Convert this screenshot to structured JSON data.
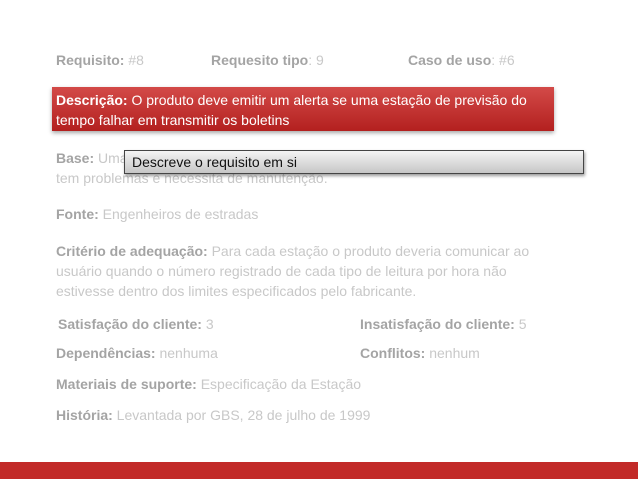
{
  "requisito": {
    "label": "Requisito:",
    "value": " #8"
  },
  "requisito_tipo": {
    "label": "Requesito tipo",
    "value": ": 9"
  },
  "caso_de_uso": {
    "label": "Caso de uso",
    "value": ": #6"
  },
  "descricao": {
    "label": "Descrição:",
    "value": " O produto deve emitir um alerta se uma estação de previsão do tempo falhar em transmitir  os boletins"
  },
  "base": {
    "label": "Base:",
    "value": " Uma estação de previsão do tempo que falha em transmitir seus boletins tem problemas e necessita de manutenção."
  },
  "callout": {
    "text": "Descreve o requisito em si"
  },
  "fonte": {
    "label": "Fonte:",
    "value": " Engenheiros de estradas"
  },
  "criterio": {
    "label": "Critério de adequação:",
    "value": " Para cada estação o produto deveria comunicar ao usuário quando o número registrado de cada tipo de leitura por hora não estivesse dentro dos limites especificados pelo fabricante."
  },
  "satisfacao": {
    "label": "Satisfação do cliente:",
    "value": " 3"
  },
  "insatisfacao": {
    "label": "Insatisfação do cliente:",
    "value": " 5"
  },
  "dependencias": {
    "label": "Dependências:",
    "value": " nenhuma"
  },
  "conflitos": {
    "label": "Conflitos:",
    "value": " nenhum"
  },
  "materiais": {
    "label": "Materiais de suporte:",
    "value": " Especificação da Estação"
  },
  "historia": {
    "label": "História:",
    "value": " Levantada por GBS, 28 de julho de 1999"
  },
  "colors": {
    "accent": "#c22a28",
    "label": "#a4a4a4",
    "value": "#c8c8c8"
  }
}
